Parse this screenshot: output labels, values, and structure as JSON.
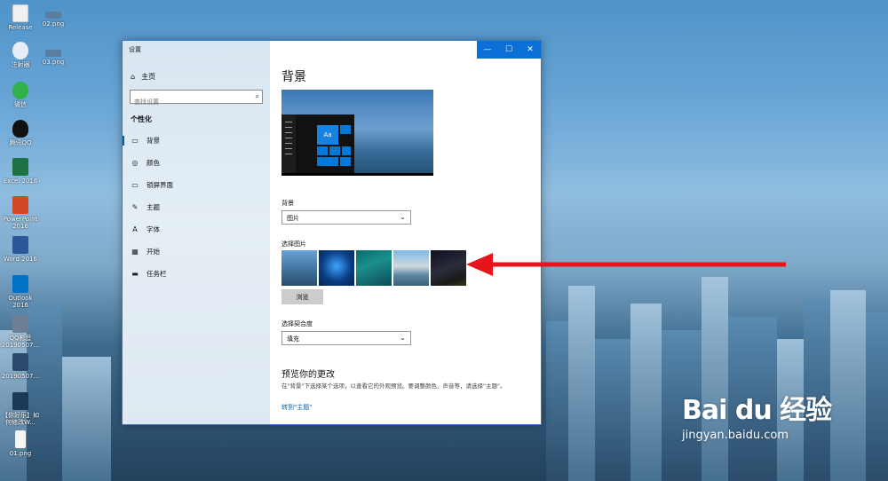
{
  "desktop": {
    "icons": [
      {
        "label": "Release",
        "name": "release-folder-icon"
      },
      {
        "label": "02.png",
        "name": "png-file-icon"
      },
      {
        "label": "注射器",
        "name": "program-icon"
      },
      {
        "label": "03.png",
        "name": "png-file-icon"
      },
      {
        "label": "微信",
        "name": "wechat-icon"
      },
      {
        "label": "腾讯QQ",
        "name": "qq-icon"
      },
      {
        "label": "Excel 2016",
        "name": "excel-icon"
      },
      {
        "label": "PowerPoint 2016",
        "name": "powerpoint-icon"
      },
      {
        "label": "Word 2016",
        "name": "word-icon"
      },
      {
        "label": "Outlook 2016",
        "name": "outlook-icon"
      },
      {
        "label": "QQ影音 20190507...",
        "name": "qq-player-icon"
      },
      {
        "label": "20190507...",
        "name": "screenshot-file-icon"
      },
      {
        "label": "【你好乐】如何修改W...",
        "name": "document-icon"
      },
      {
        "label": "01.png",
        "name": "png-file-icon"
      }
    ],
    "watermark_main": "Bai du 经验",
    "watermark_sub": "jingyan.baidu.com"
  },
  "window": {
    "title": "设置",
    "controls": {
      "minimize": "—",
      "maximize": "☐",
      "close": "✕"
    }
  },
  "sidebar": {
    "home_label": "主页",
    "search_placeholder": "查找设置",
    "section_title": "个性化",
    "items": [
      {
        "label": "背景",
        "icon": "background-icon",
        "glyph": "▭",
        "active": true
      },
      {
        "label": "颜色",
        "icon": "palette-icon",
        "glyph": "◎",
        "active": false
      },
      {
        "label": "锁屏界面",
        "icon": "lock-screen-icon",
        "glyph": "▭",
        "active": false
      },
      {
        "label": "主题",
        "icon": "theme-icon",
        "glyph": "✎",
        "active": false
      },
      {
        "label": "字体",
        "icon": "font-icon",
        "glyph": "A",
        "active": false
      },
      {
        "label": "开始",
        "icon": "start-icon",
        "glyph": "▦",
        "active": false
      },
      {
        "label": "任务栏",
        "icon": "taskbar-icon",
        "glyph": "▬",
        "active": false
      }
    ]
  },
  "content": {
    "title": "背景",
    "preview_tile_text": "Aa",
    "background_label": "背景",
    "background_value": "图片",
    "choose_picture_label": "选择图片",
    "browse_label": "浏览",
    "fit_label": "选择契合度",
    "fit_value": "填充",
    "preview_heading": "预览你的更改",
    "preview_desc": "在\"背景\"下选择某个选项，以查看它的外观预览。要调整颜色、声音等，请选择\"主题\"。",
    "theme_link": "转到\"主题\""
  },
  "colors": {
    "accent": "#0063b1",
    "close_button": "#0a6fd6",
    "annotation_arrow": "#e8141c"
  }
}
